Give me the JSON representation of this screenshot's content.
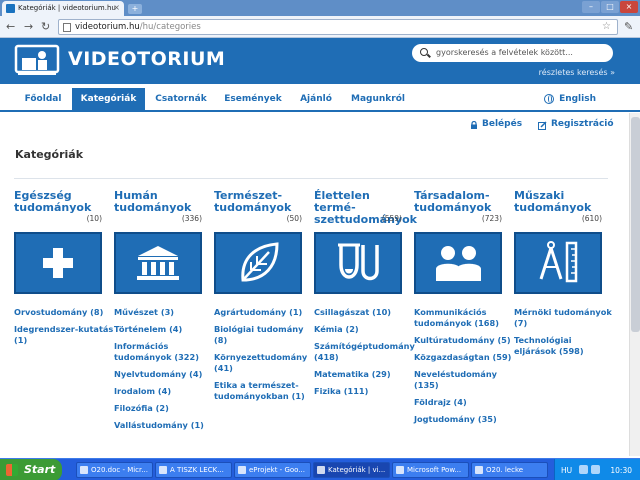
{
  "browser": {
    "tab_title": "Kategóriák | videotorium.hu",
    "url_host": "videotorium.hu",
    "url_path": "/hu/categories",
    "new_tab": "+"
  },
  "site": {
    "logo_text": "VIDEOTORIUM",
    "search_placeholder": "gyorskeresés a felvételek között...",
    "advanced_search": "részletes keresés »"
  },
  "nav": {
    "items": [
      {
        "label": "Főoldal"
      },
      {
        "label": "Kategóriák"
      },
      {
        "label": "Csatornák"
      },
      {
        "label": "Események"
      },
      {
        "label": "Ajánló"
      },
      {
        "label": "Magunkról"
      }
    ],
    "active_index": 1,
    "language": "English"
  },
  "user": {
    "login": "Belépés",
    "register": "Regisztráció"
  },
  "page": {
    "title": "Kategóriák"
  },
  "categories": [
    {
      "title": "Egészség tudományok",
      "count": "(10)",
      "icon": "plus-icon",
      "subs": [
        "Orvostudomány (8)",
        "Idegrendszer-kutatás (1)"
      ]
    },
    {
      "title": "Humán tudományok",
      "count": "(336)",
      "icon": "museum-icon",
      "subs": [
        "Művészet (3)",
        "Történelem (4)",
        "Információs tudományok (322)",
        "Nyelvtudomány (4)",
        "Irodalom (4)",
        "Filozófia (2)",
        "Vallástudomány (1)"
      ]
    },
    {
      "title": "Természet-tudományok",
      "count": "(50)",
      "icon": "leaf-icon",
      "subs": [
        "Agrártudomány (1)",
        "Biológiai tudomány (8)",
        "Környezettudomány (41)",
        "Etika a természet-tudományokban (1)"
      ]
    },
    {
      "title": "Élettelen termé-szettudományok",
      "count": "(559)",
      "icon": "flask-icon",
      "subs": [
        "Csillagászat (10)",
        "Kémia (2)",
        "Számítógéptudomány (418)",
        "Matematika (29)",
        "Fizika (111)"
      ]
    },
    {
      "title": "Társadalom-tudományok",
      "count": "(723)",
      "icon": "people-icon",
      "subs": [
        "Kommunikációs tudományok (168)",
        "Kultúratudomány (5)",
        "Közgazdaságtan (59)",
        "Neveléstudomány (135)",
        "Földrajz (4)",
        "Jogtudomány (35)"
      ]
    },
    {
      "title": "Műszaki tudományok",
      "count": "(610)",
      "icon": "compass-ruler-icon",
      "subs": [
        "Mérnöki tudományok (7)",
        "Technológiai eljárások (598)"
      ]
    }
  ],
  "taskbar": {
    "start": "Start",
    "tasks": [
      {
        "label": "O20.doc - Micr..."
      },
      {
        "label": "A TISZK LECK..."
      },
      {
        "label": "eProjekt - Goo..."
      },
      {
        "label": "Kategóriák | vi..."
      },
      {
        "label": "Microsoft Pow..."
      },
      {
        "label": "O20. lecke"
      }
    ],
    "active_index": 3,
    "lang": "HU",
    "clock": "10:30"
  },
  "colors": {
    "brand": "#1f6db5",
    "taskbar": "#245edc",
    "start": "#3c9b35"
  }
}
